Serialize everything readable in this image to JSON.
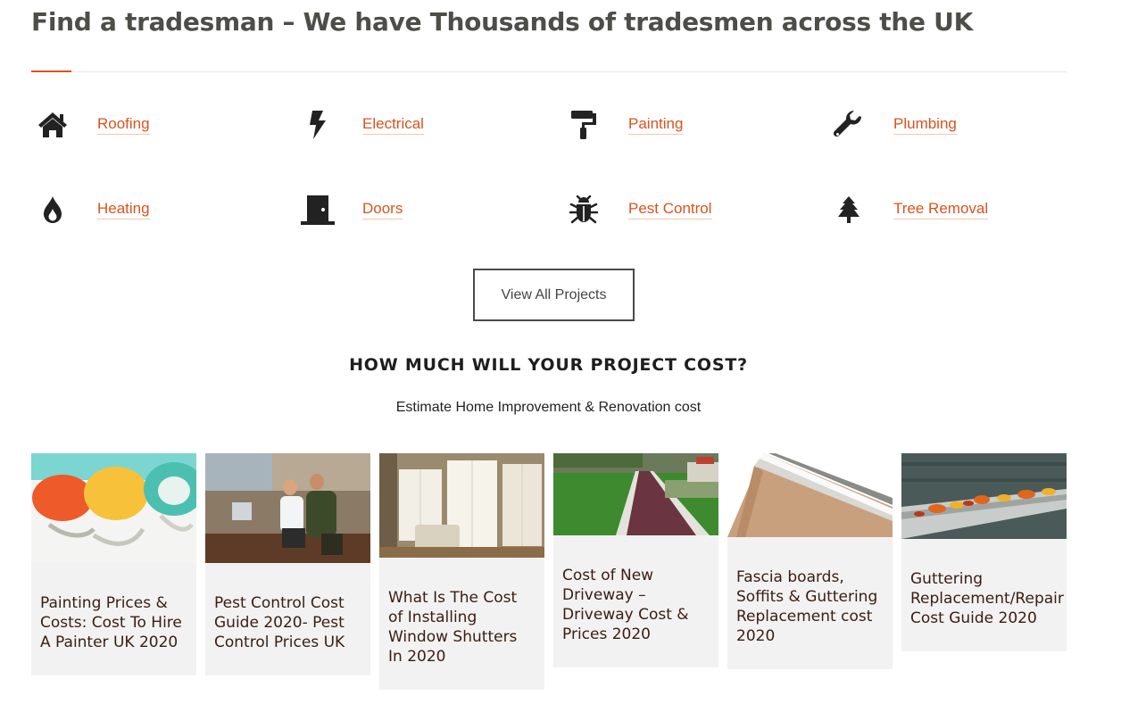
{
  "header": {
    "title": "Find a tradesman – We have Thousands of tradesmen across the UK"
  },
  "trades": [
    {
      "label": "Roofing",
      "icon": "home-icon"
    },
    {
      "label": "Electrical",
      "icon": "lightning-bolt-icon"
    },
    {
      "label": "Painting",
      "icon": "paint-roller-icon"
    },
    {
      "label": "Plumbing",
      "icon": "wrench-icon"
    },
    {
      "label": "Heating",
      "icon": "flame-icon"
    },
    {
      "label": "Doors",
      "icon": "door-icon"
    },
    {
      "label": "Pest Control",
      "icon": "bug-icon"
    },
    {
      "label": "Tree Removal",
      "icon": "tree-icon"
    }
  ],
  "view_all_label": "View All Projects",
  "cost_section": {
    "heading": "HOW MUCH WILL YOUR PROJECT COST?",
    "subheading": "Estimate Home Improvement & Renovation cost"
  },
  "articles": [
    {
      "title": "Painting Prices &\nCosts: Cost To Hire\nA Painter UK 2020",
      "image": "paint-rollers-photo"
    },
    {
      "title": "Pest Control Cost\nGuide 2020- Pest\nControl Prices UK",
      "image": "pest-control-technicians-photo"
    },
    {
      "title": "What Is The Cost\nof Installing\nWindow Shutters\nIn 2020",
      "image": "window-shutters-room-photo"
    },
    {
      "title": "Cost of New\nDriveway –\nDriveway Cost &\nPrices 2020",
      "image": "driveway-photo"
    },
    {
      "title": "Fascia boards,\nSoffits & Guttering\nReplacement cost\n2020",
      "image": "fascia-soffit-photo"
    },
    {
      "title": "Guttering\nReplacement/Repair\nCost Guide 2020",
      "image": "gutter-leaves-photo"
    }
  ],
  "colors": {
    "accent": "#e0501e",
    "link": "#d9531e",
    "title_text": "#4e4e48",
    "card_bg": "#f2f2f2",
    "card_text": "#3a1d12"
  }
}
